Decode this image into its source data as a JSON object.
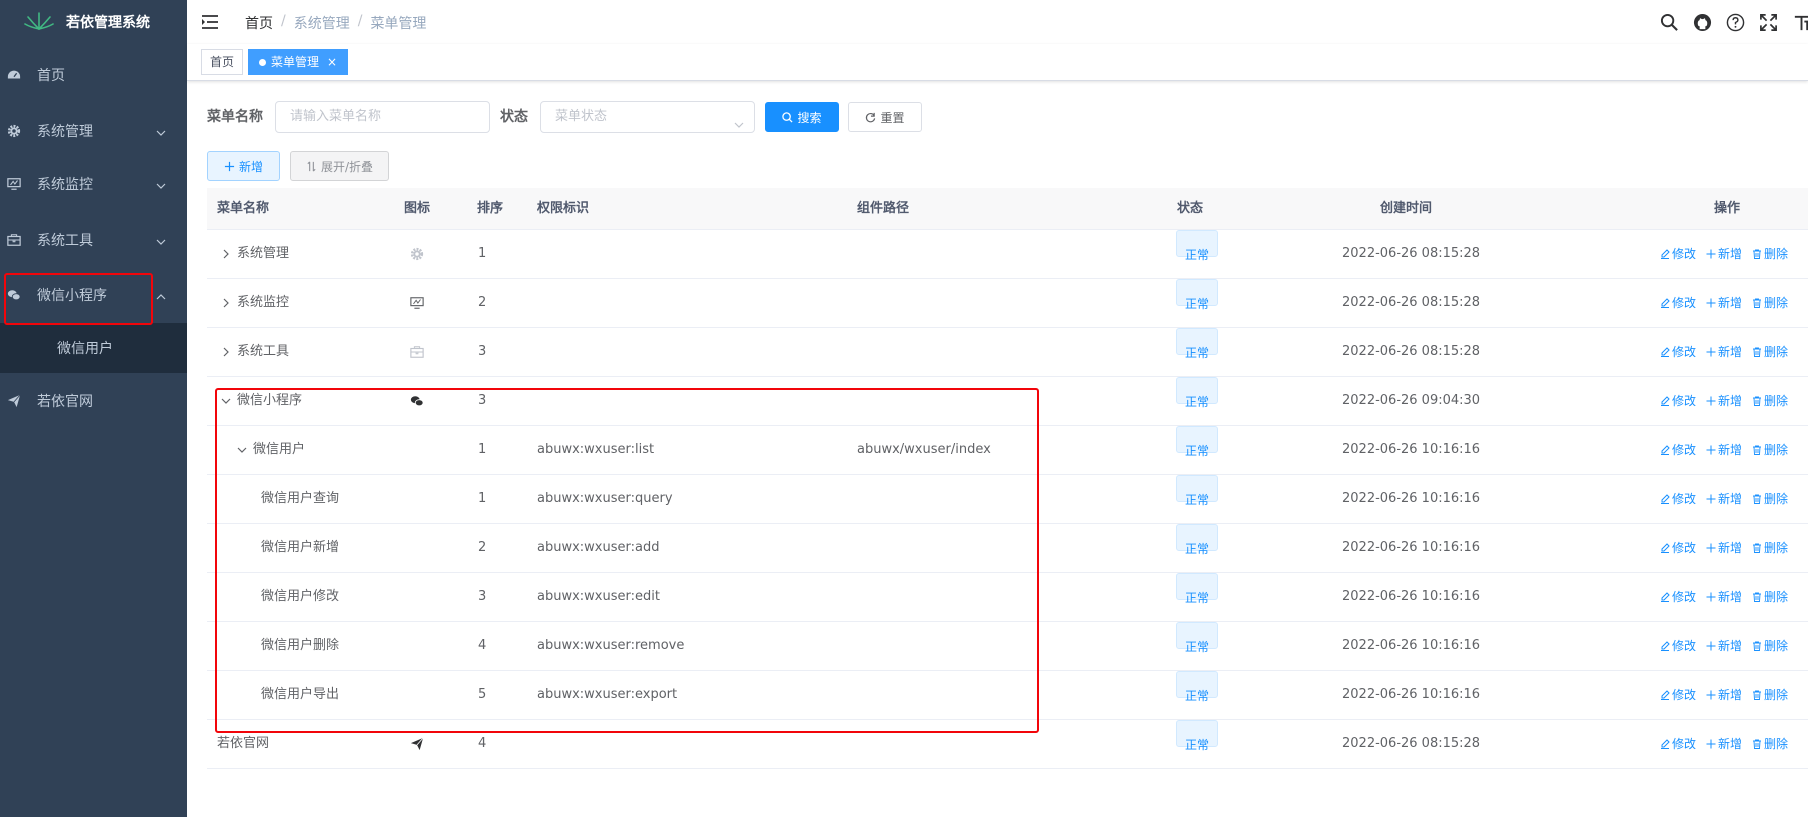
{
  "app": {
    "title": "若依管理系统"
  },
  "colors": {
    "sidebar_bg": "#304156",
    "sidebar_sub_bg": "#1f2d3d",
    "primary": "#1890ff",
    "highlight": "#f2050a"
  },
  "sidebar": {
    "items": [
      {
        "label": "首页",
        "icon": "dashboard-icon"
      },
      {
        "label": "系统管理",
        "icon": "gear-icon",
        "expandable": true
      },
      {
        "label": "系统监控",
        "icon": "monitor-icon",
        "expandable": true
      },
      {
        "label": "系统工具",
        "icon": "toolbox-icon",
        "expandable": true
      },
      {
        "label": "微信小程序",
        "icon": "wechat-icon",
        "expandable": true,
        "expanded": true
      },
      {
        "label": "若依官网",
        "icon": "paper-plane-icon"
      }
    ],
    "sub_items": [
      {
        "label": "微信用户"
      }
    ]
  },
  "navbar": {
    "breadcrumb": [
      "首页",
      "系统管理",
      "菜单管理"
    ],
    "separator": "/",
    "icons": [
      "search-icon",
      "github-icon",
      "help-icon",
      "fullscreen-icon",
      "size-icon"
    ]
  },
  "tags": [
    {
      "label": "首页",
      "active": false
    },
    {
      "label": "菜单管理",
      "active": true,
      "close": "×"
    }
  ],
  "search": {
    "name_label": "菜单名称",
    "name_placeholder": "请输入菜单名称",
    "status_label": "状态",
    "status_placeholder": "菜单状态",
    "search_button": "搜索",
    "reset_button": "重置"
  },
  "toolbar": {
    "add_button": "新增",
    "toggle_button": "展开/折叠"
  },
  "table": {
    "columns": [
      "菜单名称",
      "图标",
      "排序",
      "权限标识",
      "组件路径",
      "状态",
      "创建时间",
      "操作"
    ],
    "actions": [
      "修改",
      "新增",
      "删除"
    ],
    "rows": [
      {
        "name": "系统管理",
        "level": 0,
        "tree": "collapsed",
        "icon": "gear-icon",
        "order": "1",
        "perm": "",
        "path": "",
        "status": "正常",
        "created": "2022-06-26 08:15:28"
      },
      {
        "name": "系统监控",
        "level": 0,
        "tree": "collapsed",
        "icon": "monitor-icon",
        "order": "2",
        "perm": "",
        "path": "",
        "status": "正常",
        "created": "2022-06-26 08:15:28"
      },
      {
        "name": "系统工具",
        "level": 0,
        "tree": "collapsed",
        "icon": "toolbox-icon",
        "order": "3",
        "perm": "",
        "path": "",
        "status": "正常",
        "created": "2022-06-26 08:15:28"
      },
      {
        "name": "微信小程序",
        "level": 0,
        "tree": "expanded",
        "icon": "wechat-icon",
        "order": "3",
        "perm": "",
        "path": "",
        "status": "正常",
        "created": "2022-06-26 09:04:30"
      },
      {
        "name": "微信用户",
        "level": 1,
        "tree": "expanded",
        "icon": "",
        "order": "1",
        "perm": "abuwx:wxuser:list",
        "path": "abuwx/wxuser/index",
        "status": "正常",
        "created": "2022-06-26 10:16:16"
      },
      {
        "name": "微信用户查询",
        "level": 2,
        "tree": "none",
        "icon": "",
        "order": "1",
        "perm": "abuwx:wxuser:query",
        "path": "",
        "status": "正常",
        "created": "2022-06-26 10:16:16"
      },
      {
        "name": "微信用户新增",
        "level": 2,
        "tree": "none",
        "icon": "",
        "order": "2",
        "perm": "abuwx:wxuser:add",
        "path": "",
        "status": "正常",
        "created": "2022-06-26 10:16:16"
      },
      {
        "name": "微信用户修改",
        "level": 2,
        "tree": "none",
        "icon": "",
        "order": "3",
        "perm": "abuwx:wxuser:edit",
        "path": "",
        "status": "正常",
        "created": "2022-06-26 10:16:16"
      },
      {
        "name": "微信用户删除",
        "level": 2,
        "tree": "none",
        "icon": "",
        "order": "4",
        "perm": "abuwx:wxuser:remove",
        "path": "",
        "status": "正常",
        "created": "2022-06-26 10:16:16"
      },
      {
        "name": "微信用户导出",
        "level": 2,
        "tree": "none",
        "icon": "",
        "order": "5",
        "perm": "abuwx:wxuser:export",
        "path": "",
        "status": "正常",
        "created": "2022-06-26 10:16:16"
      },
      {
        "name": "若依官网",
        "level": 0,
        "tree": "leaf-root",
        "icon": "paper-plane-icon",
        "order": "4",
        "perm": "",
        "path": "",
        "status": "正常",
        "created": "2022-06-26 08:15:28"
      }
    ]
  }
}
